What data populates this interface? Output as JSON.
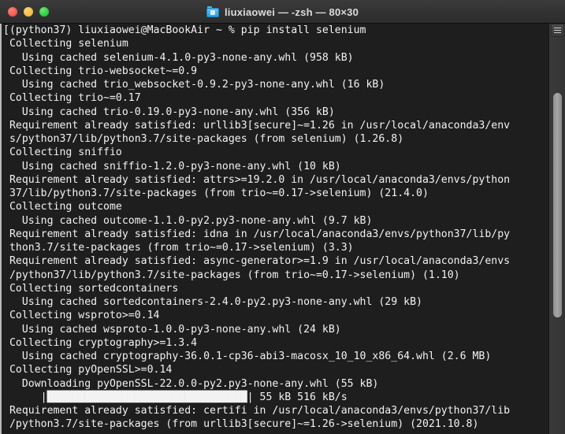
{
  "window": {
    "title": "liuxiaowei — -zsh — 80×30",
    "icon": "folder-icon",
    "traffic_lights": {
      "close": "close-button",
      "minimize": "minimize-button",
      "maximize": "maximize-button"
    },
    "colors": {
      "titlebar_bg": "#333333",
      "terminal_bg": "#1e1e1e",
      "terminal_fg": "#f2f2f2",
      "close": "#f2554b",
      "minimize": "#f5bc3f",
      "maximize": "#28c940",
      "folder_icon": "#2b9fe0",
      "scrollbar_thumb": "#a6a6a6"
    }
  },
  "terminal": {
    "command": "pip install selenium",
    "prompt": "(python37) liuxiaowei@MacBookAir ~ % ",
    "columns": 80,
    "rows": 30,
    "lines": [
      "[(python37) liuxiaowei@MacBookAir ~ % pip install selenium",
      " Collecting selenium",
      "   Using cached selenium-4.1.0-py3-none-any.whl (958 kB)",
      " Collecting trio-websocket~=0.9",
      "   Using cached trio_websocket-0.9.2-py3-none-any.whl (16 kB)",
      " Collecting trio~=0.17",
      "   Using cached trio-0.19.0-py3-none-any.whl (356 kB)",
      " Requirement already satisfied: urllib3[secure]~=1.26 in /usr/local/anaconda3/env",
      " s/python37/lib/python3.7/site-packages (from selenium) (1.26.8)",
      " Collecting sniffio",
      "   Using cached sniffio-1.2.0-py3-none-any.whl (10 kB)",
      " Requirement already satisfied: attrs>=19.2.0 in /usr/local/anaconda3/envs/python",
      " 37/lib/python3.7/site-packages (from trio~=0.17->selenium) (21.4.0)",
      " Collecting outcome",
      "   Using cached outcome-1.1.0-py2.py3-none-any.whl (9.7 kB)",
      " Requirement already satisfied: idna in /usr/local/anaconda3/envs/python37/lib/py",
      " thon3.7/site-packages (from trio~=0.17->selenium) (3.3)",
      " Requirement already satisfied: async-generator>=1.9 in /usr/local/anaconda3/envs",
      " /python37/lib/python3.7/site-packages (from trio~=0.17->selenium) (1.10)",
      " Collecting sortedcontainers",
      "   Using cached sortedcontainers-2.4.0-py2.py3-none-any.whl (29 kB)",
      " Collecting wsproto>=0.14",
      "   Using cached wsproto-1.0.0-py3-none-any.whl (24 kB)",
      " Collecting cryptography>=1.3.4",
      "   Using cached cryptography-36.0.1-cp36-abi3-macosx_10_10_x86_64.whl (2.6 MB)",
      " Collecting pyOpenSSL>=0.14",
      "   Downloading pyOpenSSL-22.0.0-py2.py3-none-any.whl (55 kB)",
      "      |████████████████████████████████| 55 kB 516 kB/s",
      " Requirement already satisfied: certifi in /usr/local/anaconda3/envs/python37/lib",
      " /python3.7/site-packages (from urllib3[secure]~=1.26->selenium) (2021.10.8)"
    ],
    "download_progress": {
      "package": "pyOpenSSL-22.0.0-py2.py3-none-any.whl",
      "size": "55 kB",
      "percent": 100,
      "speed": "516 kB/s",
      "downloaded": "55 kB"
    }
  },
  "scrollbar": {
    "position_label": "scroll-thumb"
  }
}
